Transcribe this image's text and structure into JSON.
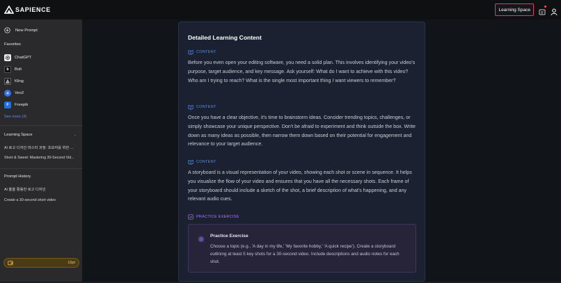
{
  "brand": {
    "name": "SAPIENCE"
  },
  "topbar": {
    "learning_space_label": "Learning Space"
  },
  "sidebar": {
    "new_prompt": "New Prompt",
    "favorites_header": "Favorites",
    "favorites": [
      {
        "label": "ChatGPT",
        "icon": "chatgpt-icon"
      },
      {
        "label": "Bolt",
        "icon": "bolt-icon"
      },
      {
        "label": "Kling",
        "icon": "kling-icon"
      },
      {
        "label": "Veo2",
        "icon": "veo2-icon"
      },
      {
        "label": "Freepik",
        "icon": "freepik-icon"
      }
    ],
    "see_more": "See more (3)",
    "learning_space_header": "Learning Space",
    "learning_items": [
      "AI 로고 디자인 마스터 과정: 초보자를 위한 ...",
      "Short & Sweet: Mastering 30-Second Vid..."
    ],
    "prompt_history_header": "Prompt History",
    "history_items": [
      "AI 툴을 활용한 로고 디자인",
      "Create a 30-second short video"
    ],
    "points": "10pt"
  },
  "content": {
    "title": "Detailed Learning Content",
    "sections": [
      {
        "label": "CONTENT",
        "text": "Before you even open your editing software, you need a solid plan. This involves identifying your video's purpose, target audience, and key message. Ask yourself: What do I want to achieve with this video? Who am I trying to reach? What is the single most important thing I want viewers to remember?"
      },
      {
        "label": "CONTENT",
        "text": "Once you have a clear objective, it's time to brainstorm ideas. Consider trending topics, challenges, or simply showcase your unique perspective. Don't be afraid to experiment and think outside the box. Write down as many ideas as possible, then narrow them down based on their potential for engagement and relevance to your target audience."
      },
      {
        "label": "CONTENT",
        "text": "A storyboard is a visual representation of your video, showing each shot or scene in sequence. It helps you visualize the flow of your video and ensures that you have all the necessary shots. Each frame of your storyboard should include a sketch of the shot, a brief description of what's happening, and any relevant audio cues."
      }
    ],
    "practice_label": "PRACTICE EXERCISE",
    "exercise": {
      "title": "Practice Exercise",
      "text": "Choose a topic (e.g., 'A day in my life,' 'My favorite hobby,' 'A quick recipe'). Create a storyboard outlining at least 5 key shots for a 30-second video. Include descriptions and audio notes for each shot."
    }
  },
  "colors": {
    "accent_blue": "#4f8ff2",
    "accent_purple": "#a87af5",
    "highlight_border": "#d63b7a",
    "points_gold": "#f3c55a"
  }
}
